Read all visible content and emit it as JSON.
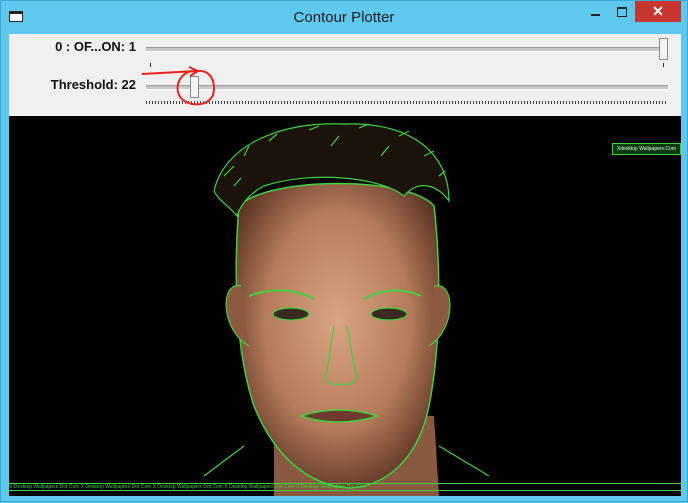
{
  "window": {
    "title": "Contour Plotter"
  },
  "controls": {
    "minimize_icon": "minimize-icon",
    "maximize_icon": "maximize-icon",
    "close_icon": "close-icon",
    "close_glyph": "✕"
  },
  "trackbars": [
    {
      "label": "0 : OF...ON: 1",
      "value": 1,
      "max": 1
    },
    {
      "label": "Threshold: 22",
      "value": 22,
      "max": 255
    }
  ],
  "image": {
    "watermark_badge": "Xdesktop Wallpapers.Com",
    "watermark_strip": "X Desktop Wallpapers Dot Com     X Desktop Wallpapers Dot Com     X Desktop Wallpapers Dot Com     X Desktop Wallpapers Dot Com     X Desktop Wallpapers Dot Com",
    "contour_color": "#3fd13f"
  },
  "annotation": {
    "color": "#e8231f"
  }
}
